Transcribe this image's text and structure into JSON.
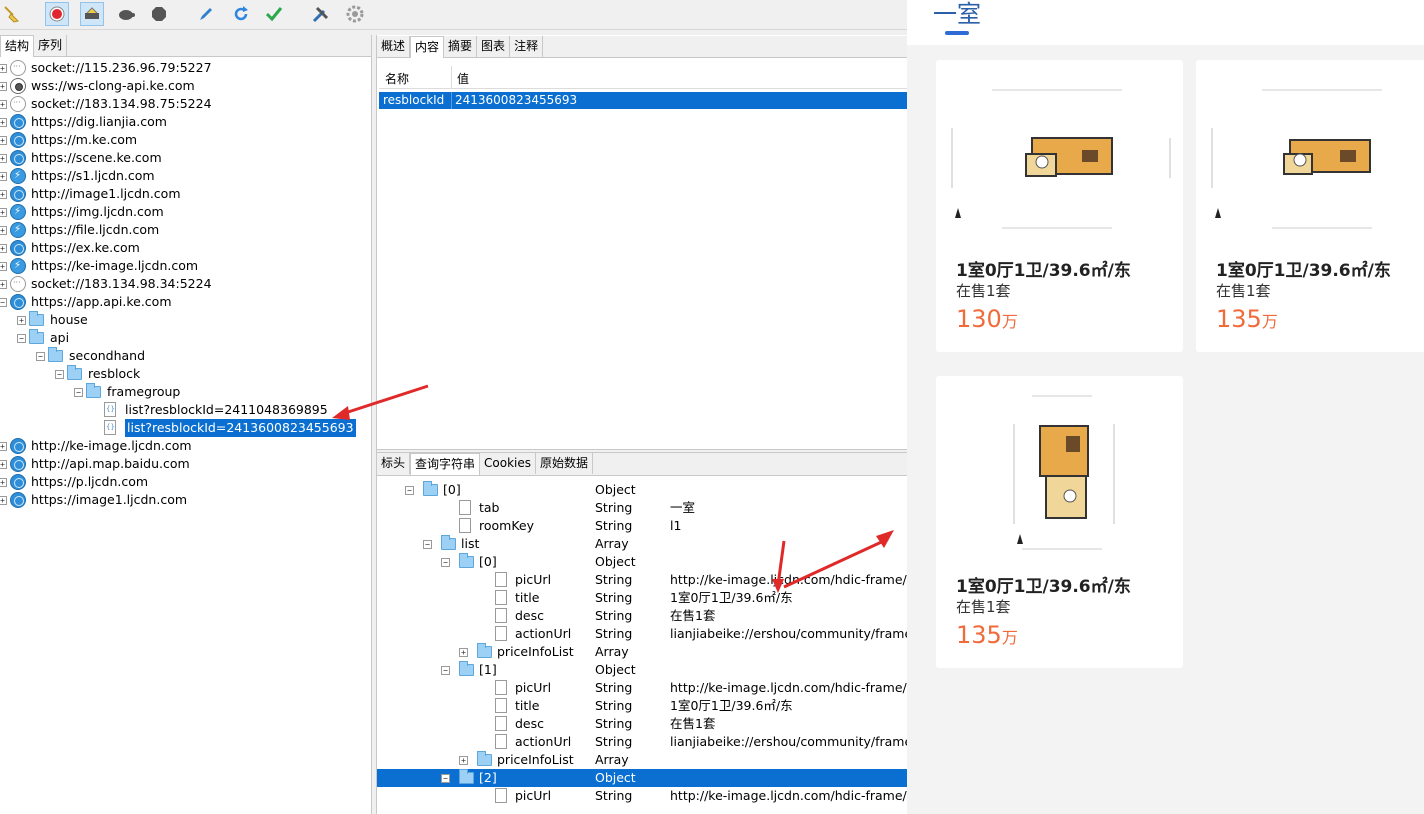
{
  "toolbar": {
    "icons": [
      "broom-icon",
      "record-icon",
      "throttle-icon",
      "turtle-icon",
      "stop-icon",
      "pen-icon",
      "refresh-icon",
      "check-icon",
      "tools-icon",
      "settings-icon"
    ]
  },
  "left_panel": {
    "tabs": [
      "结构",
      "序列"
    ],
    "hosts": [
      {
        "label": "socket://115.236.96.79:5227",
        "icon": "socket-icon"
      },
      {
        "label": "wss://ws-clong-api.ke.com",
        "icon": "websocket-icon"
      },
      {
        "label": "socket://183.134.98.75:5224",
        "icon": "socket-icon"
      },
      {
        "label": "https://dig.lianjia.com",
        "icon": "globe-icon"
      },
      {
        "label": "https://m.ke.com",
        "icon": "globe-icon"
      },
      {
        "label": "https://scene.ke.com",
        "icon": "globe-icon"
      },
      {
        "label": "https://s1.ljcdn.com",
        "icon": "bolt-icon"
      },
      {
        "label": "http://image1.ljcdn.com",
        "icon": "globe-icon"
      },
      {
        "label": "https://img.ljcdn.com",
        "icon": "bolt-icon"
      },
      {
        "label": "https://file.ljcdn.com",
        "icon": "bolt-icon"
      },
      {
        "label": "https://ex.ke.com",
        "icon": "globe-icon"
      },
      {
        "label": "https://ke-image.ljcdn.com",
        "icon": "bolt-icon"
      },
      {
        "label": "socket://183.134.98.34:5224",
        "icon": "socket-icon"
      },
      {
        "label": "https://app.api.ke.com",
        "icon": "globe-icon"
      }
    ],
    "children": {
      "house": "house",
      "api": "api",
      "secondhand": "secondhand",
      "resblock": "resblock",
      "framegroup": "framegroup",
      "req1": "list?resblockId=2411048369895",
      "req2": "list?resblockId=2413600823455693"
    },
    "hosts_after": [
      {
        "label": "http://ke-image.ljcdn.com",
        "icon": "globe-icon"
      },
      {
        "label": "http://api.map.baidu.com",
        "icon": "globe-icon"
      },
      {
        "label": "https://p.ljcdn.com",
        "icon": "globe-icon"
      },
      {
        "label": "https://image1.ljcdn.com",
        "icon": "globe-icon"
      }
    ]
  },
  "mid_panel": {
    "tabs": [
      "概述",
      "内容",
      "摘要",
      "图表",
      "注释"
    ],
    "header": {
      "name": "名称",
      "value": "值"
    },
    "param_row": {
      "name": "resblockId",
      "value": "2413600823455693"
    },
    "lower_tabs": [
      "标头",
      "查询字符串",
      "Cookies",
      "原始数据"
    ],
    "json_rows": [
      {
        "name": "[0]",
        "type": "Object",
        "value": "",
        "kind": "folder"
      },
      {
        "name": "tab",
        "type": "String",
        "value": "一室",
        "kind": "file"
      },
      {
        "name": "roomKey",
        "type": "String",
        "value": "l1",
        "kind": "file"
      },
      {
        "name": "list",
        "type": "Array",
        "value": "",
        "kind": "folder"
      },
      {
        "name": "[0]",
        "type": "Object",
        "value": "",
        "kind": "folder"
      },
      {
        "name": "picUrl",
        "type": "String",
        "value": "http://ke-image.ljcdn.com/hdic-frame/sta",
        "kind": "file"
      },
      {
        "name": "title",
        "type": "String",
        "value": "1室0厅1卫/39.6㎡/东",
        "kind": "file"
      },
      {
        "name": "desc",
        "type": "String",
        "value": "在售1套",
        "kind": "file"
      },
      {
        "name": "actionUrl",
        "type": "String",
        "value": "lianjiabeike://ershou/community/frameDe",
        "kind": "file"
      },
      {
        "name": "priceInfoList",
        "type": "Array",
        "value": "",
        "kind": "folder"
      },
      {
        "name": "[1]",
        "type": "Object",
        "value": "",
        "kind": "folder"
      },
      {
        "name": "picUrl",
        "type": "String",
        "value": "http://ke-image.ljcdn.com/hdic-frame/sta",
        "kind": "file"
      },
      {
        "name": "title",
        "type": "String",
        "value": "1室0厅1卫/39.6㎡/东",
        "kind": "file"
      },
      {
        "name": "desc",
        "type": "String",
        "value": "在售1套",
        "kind": "file"
      },
      {
        "name": "actionUrl",
        "type": "String",
        "value": "lianjiabeike://ershou/community/frameDe",
        "kind": "file"
      },
      {
        "name": "priceInfoList",
        "type": "Array",
        "value": "",
        "kind": "folder"
      },
      {
        "name": "[2]",
        "type": "Object",
        "value": "",
        "kind": "folder"
      },
      {
        "name": "picUrl",
        "type": "String",
        "value": "http://ke-image.ljcdn.com/hdic-frame/sta",
        "kind": "file"
      }
    ]
  },
  "phone": {
    "tab_title": "一室",
    "cards": [
      {
        "title": "1室0厅1卫/39.6㎡/东",
        "desc": "在售1套",
        "price": "130",
        "unit": "万"
      },
      {
        "title": "1室0厅1卫/39.6㎡/东",
        "desc": "在售1套",
        "price": "135",
        "unit": "万"
      },
      {
        "title": "1室0厅1卫/39.6㎡/东",
        "desc": "在售1套",
        "price": "135",
        "unit": "万"
      }
    ]
  },
  "colors": {
    "selection": "#0a6fd0",
    "price": "#f06a3a",
    "tab_accent": "#2f6bd7",
    "annotation_arrow": "#e02a2a"
  }
}
